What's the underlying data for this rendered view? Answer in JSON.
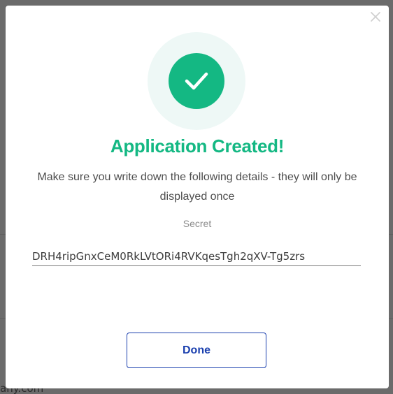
{
  "backdrop": {
    "partial_text": "any.com"
  },
  "dialog": {
    "close_icon": "close-icon",
    "status_icon": "checkmark-icon",
    "title": "Application Created!",
    "message": "Make sure you write down the following details - they will only be displayed once",
    "secret": {
      "label": "Secret",
      "value": "DRH4ripGnxCeM0RkLVtORi4RVKqesTgh2qXV-Tg5zrs"
    },
    "done_label": "Done"
  },
  "colors": {
    "accent": "#14b883",
    "button_text": "#1a3fae",
    "halo": "#eef8f6"
  }
}
